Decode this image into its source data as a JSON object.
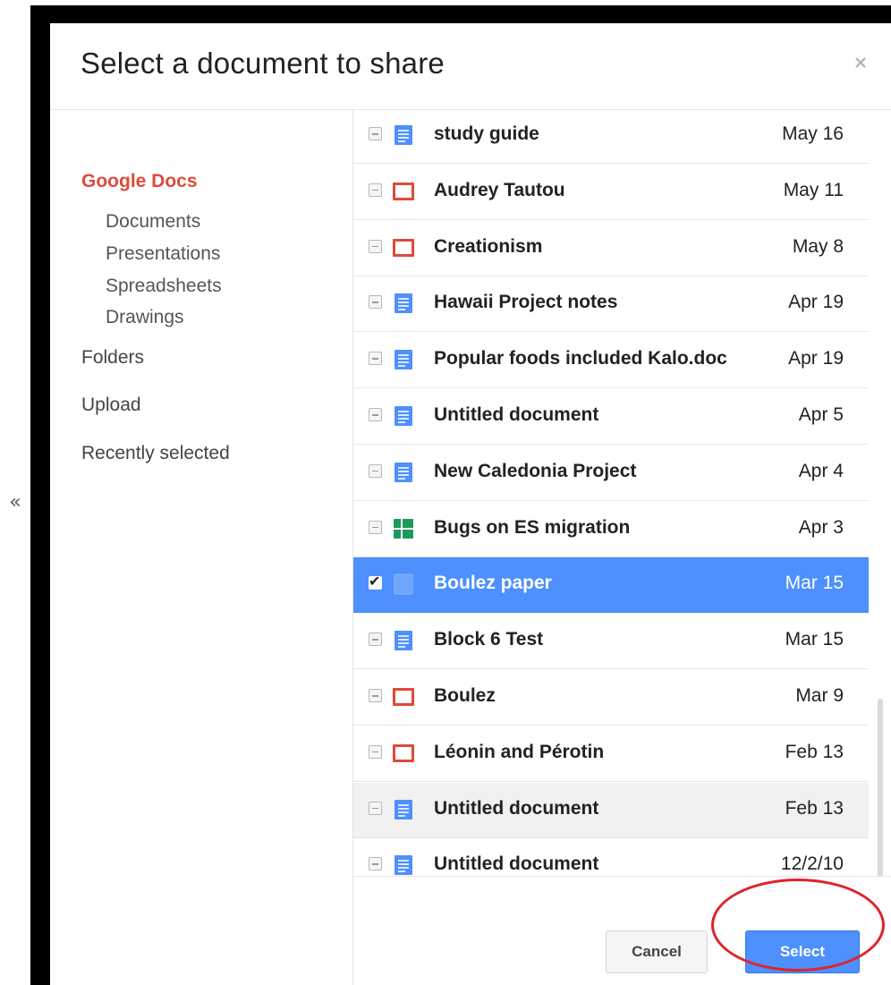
{
  "dialog": {
    "title": "Select a document to share",
    "close_icon": "close-icon"
  },
  "collapse": {
    "label": "«"
  },
  "sidebar": {
    "items": [
      {
        "label": "Google Docs",
        "active": true
      },
      {
        "label": "Documents"
      },
      {
        "label": "Presentations"
      },
      {
        "label": "Spreadsheets"
      },
      {
        "label": "Drawings"
      },
      {
        "label": "Folders"
      },
      {
        "label": "Upload"
      },
      {
        "label": "Recently selected"
      }
    ]
  },
  "documents": [
    {
      "title": "study guide",
      "date": "May 16",
      "type": "document"
    },
    {
      "title": "Audrey Tautou",
      "date": "May 11",
      "type": "presentation"
    },
    {
      "title": "Creationism",
      "date": "May 8",
      "type": "presentation"
    },
    {
      "title": "Hawaii Project notes",
      "date": "Apr 19",
      "type": "document"
    },
    {
      "title": "Popular foods included Kalo.doc",
      "date": "Apr 19",
      "type": "document"
    },
    {
      "title": "Untitled document",
      "date": "Apr 5",
      "type": "document"
    },
    {
      "title": "New Caledonia Project",
      "date": "Apr 4",
      "type": "document"
    },
    {
      "title": "Bugs on ES migration",
      "date": "Apr 3",
      "type": "spreadsheet"
    },
    {
      "title": "Boulez paper",
      "date": "Mar 15",
      "type": "document",
      "selected": true
    },
    {
      "title": "Block 6 Test",
      "date": "Mar 15",
      "type": "document"
    },
    {
      "title": "Boulez",
      "date": "Mar 9",
      "type": "presentation"
    },
    {
      "title": "Léonin and Pérotin",
      "date": "Feb 13",
      "type": "presentation"
    },
    {
      "title": "Untitled document",
      "date": "Feb 13",
      "type": "document",
      "hover": true
    },
    {
      "title": "Untitled document",
      "date": "12/2/10",
      "type": "document"
    }
  ],
  "footer": {
    "cancel_label": "Cancel",
    "select_label": "Select"
  },
  "colors": {
    "accent": "#4d90fe",
    "active_nav": "#dd4b39",
    "document_icon": "#4d90fe",
    "presentation_icon": "#dd4b39",
    "spreadsheet_icon": "#1a9b5a",
    "annotation_ring": "#e0232a"
  }
}
